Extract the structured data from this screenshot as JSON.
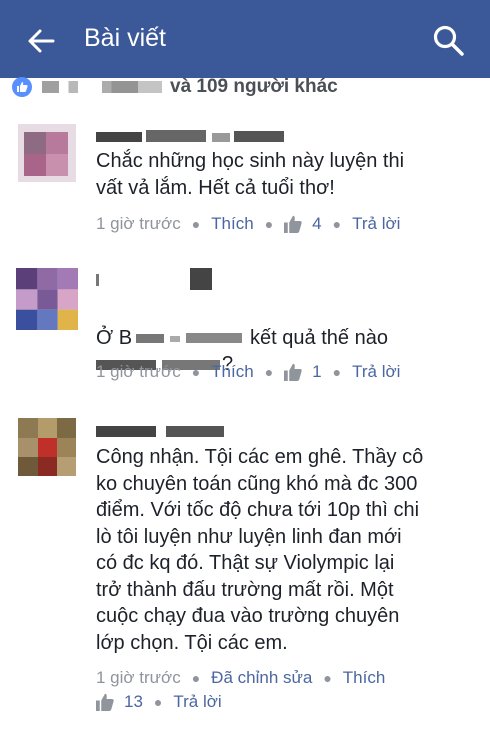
{
  "header": {
    "title": "Bài viết"
  },
  "likes": {
    "text": "và 109 người khác"
  },
  "comments": [
    {
      "text": "Chắc những học sinh này luyện thi\nvất vả lắm. Hết cả tuổi thơ!",
      "time": "1 giờ trước",
      "like_label": "Thích",
      "like_count": "4",
      "reply_label": "Trả lời"
    },
    {
      "text_a": "Ở B",
      "text_b": "kết quả thế nào",
      "text_c": "?",
      "time": "1 giờ trước",
      "like_label": "Thích",
      "like_count": "1",
      "reply_label": "Trả lời"
    },
    {
      "text": "Công nhận. Tội các em ghê. Thầy cô\nko chuyên toán cũng khó mà đc 300\nđiểm. Với tốc độ chưa tới 10p thì chi\nlò tôi luyện như luyện linh đan mới\ncó đc kq đó. Thật sự Violympic lại\ntrở thành đấu trường mất rồi. Một\ncuộc chạy đua vào trường chuyên\nlớp chọn. Tội các em.",
      "time": "1 giờ trước",
      "edited_label": "Đã chỉnh sửa",
      "like_label": "Thích",
      "like_count": "13",
      "reply_label": "Trả lời"
    }
  ],
  "colors": {
    "header_bg": "#3b5998",
    "link": "#4b67a1",
    "meta": "#90949c",
    "like_badge": "#5890ff"
  }
}
